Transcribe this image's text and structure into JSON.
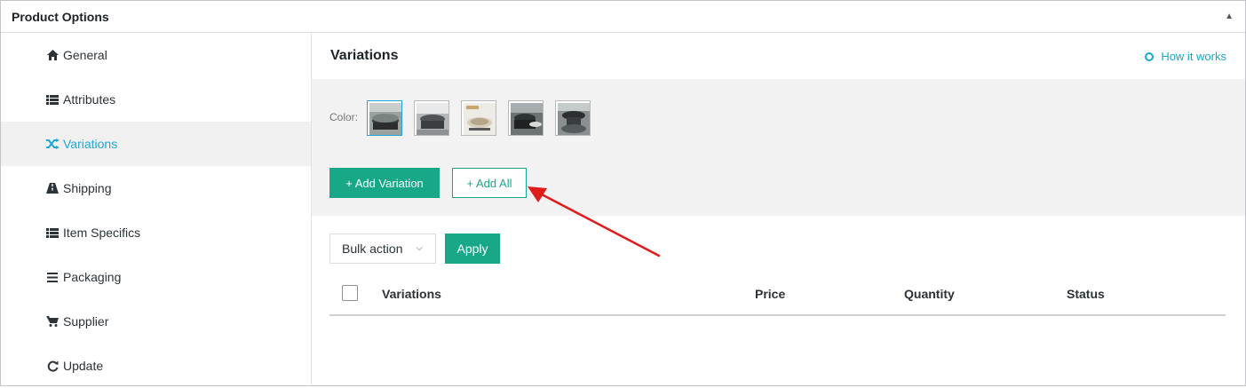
{
  "panel": {
    "title": "Product Options"
  },
  "sidebar": {
    "items": [
      {
        "label": "General",
        "icon": "home-icon"
      },
      {
        "label": "Attributes",
        "icon": "list-icon"
      },
      {
        "label": "Variations",
        "icon": "shuffle-icon",
        "active": true
      },
      {
        "label": "Shipping",
        "icon": "road-icon"
      },
      {
        "label": "Item Specifics",
        "icon": "list-icon"
      },
      {
        "label": "Packaging",
        "icon": "bars-icon"
      },
      {
        "label": "Supplier",
        "icon": "cart-icon"
      },
      {
        "label": "Update",
        "icon": "refresh-icon"
      }
    ]
  },
  "main": {
    "title": "Variations",
    "how_it_works": "How it works",
    "color_label": "Color:",
    "swatch_count": 5,
    "add_variation": "+ Add Variation",
    "add_all": "+ Add All",
    "bulk_action": "Bulk action",
    "apply": "Apply",
    "columns": [
      "Variations",
      "Price",
      "Quantity",
      "Status"
    ]
  },
  "colors": {
    "accent_green": "#18a887",
    "link_blue": "#16a8cb",
    "active_blue": "#22a7d5",
    "annotation_red": "#e01b1b"
  }
}
